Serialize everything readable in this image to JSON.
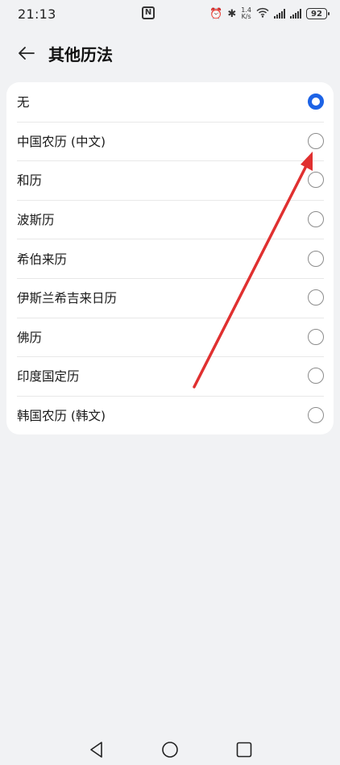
{
  "status_bar": {
    "time": "21:13",
    "nfc_label": "N",
    "speed_top": "1.4",
    "speed_bottom": "K/s",
    "battery": "92"
  },
  "header": {
    "title": "其他历法",
    "back_icon": "arrow-left-icon"
  },
  "options": [
    {
      "label": "无",
      "selected": true
    },
    {
      "label": "中国农历 (中文)",
      "selected": false
    },
    {
      "label": "和历",
      "selected": false
    },
    {
      "label": "波斯历",
      "selected": false
    },
    {
      "label": "希伯来历",
      "selected": false
    },
    {
      "label": "伊斯兰希吉来日历",
      "selected": false
    },
    {
      "label": "佛历",
      "selected": false
    },
    {
      "label": "印度国定历",
      "selected": false
    },
    {
      "label": "韩国农历 (韩文)",
      "selected": false
    }
  ],
  "colors": {
    "accent": "#1d63e6",
    "annotation": "#e03030",
    "background": "#f1f2f4",
    "card": "#ffffff"
  },
  "nav_bar": {
    "icons": [
      "back-triangle-icon",
      "home-circle-icon",
      "recents-square-icon"
    ]
  }
}
